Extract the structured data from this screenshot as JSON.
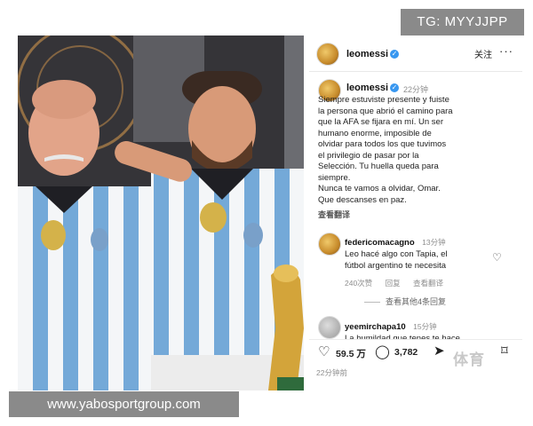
{
  "overlays": {
    "tg_label": "TG: MYYJJPP",
    "site_label": "www.yabosportgroup.com"
  },
  "post": {
    "username": "leomessi",
    "follow_label": "关注",
    "more_label": "···"
  },
  "caption": {
    "username": "leomessi",
    "time": "22分钟",
    "lines": [
      "Siempre estuviste presente y fuiste",
      "la persona que abrió el camino para",
      "que la AFA se fijara en mí. Un ser",
      "humano enorme, imposible de",
      "olvidar para todos los que tuvimos",
      "el privilegio de pasar por la",
      "Selección. Tu huella queda para",
      "siempre.",
      "Nunca te vamos a olvidar, Omar.",
      "Que descanses en paz."
    ],
    "translate_label": "查看翻译"
  },
  "comments": [
    {
      "username": "federicomacagno",
      "time": "13分钟",
      "lines": [
        "Leo hacé algo con Tapia, el",
        "fútbol argentino te necesita"
      ],
      "likes": "240次赞",
      "reply": "回复",
      "translate": "查看翻译",
      "view_replies": "查看其他4条回复"
    },
    {
      "username": "yeemirchapa10",
      "time": "15分钟",
      "lines": [
        "La humildad que tenes te hace"
      ]
    }
  ],
  "actions": {
    "likes": "59.5 万",
    "comments": "3,782",
    "posted": "22分钟前"
  },
  "watermark": "体育",
  "colors": {
    "verified": "#3897f0",
    "overlay_gray": "#8a8a8a",
    "jersey_blue": "#75aadb"
  },
  "icons": [
    "verified-badge-icon",
    "more-icon",
    "heart-icon",
    "comment-icon",
    "share-icon",
    "bookmark-icon"
  ]
}
